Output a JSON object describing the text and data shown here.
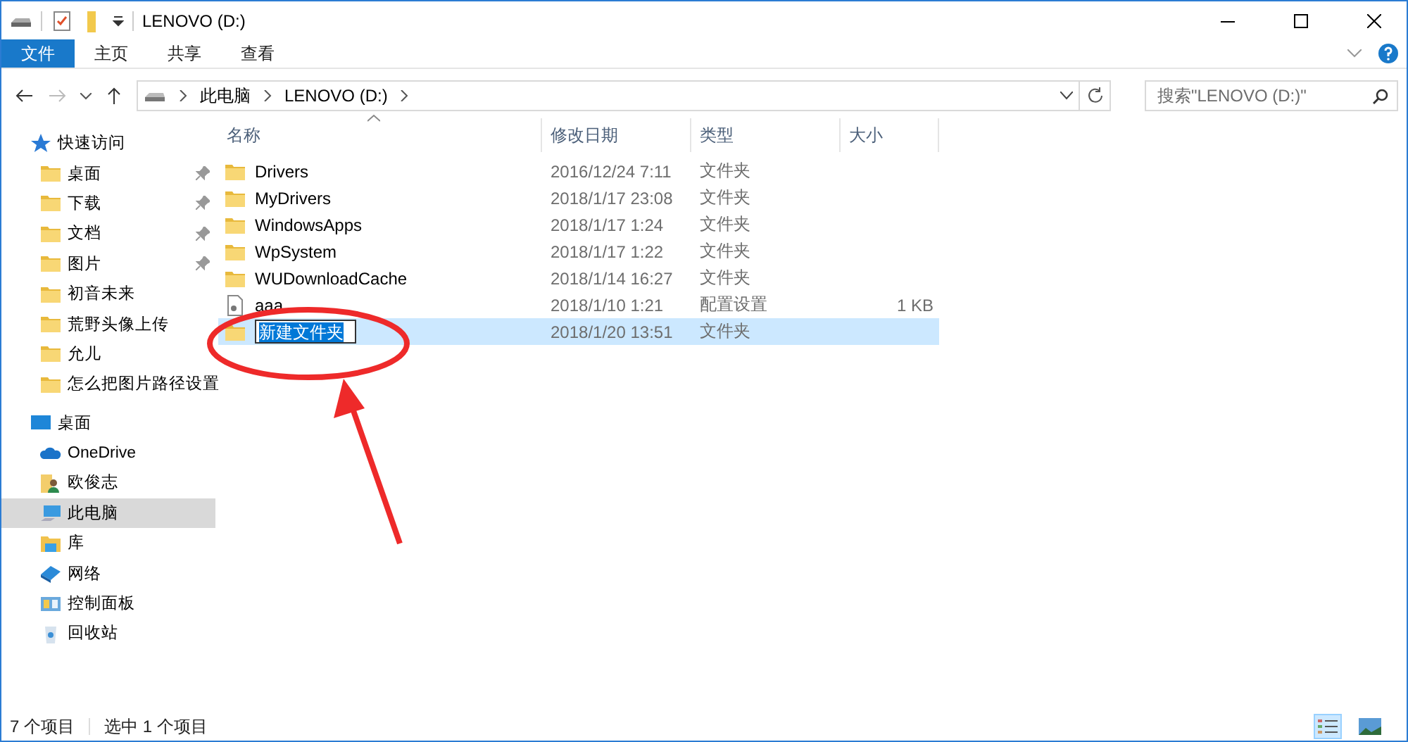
{
  "window": {
    "title": "LENOVO (D:)"
  },
  "ribbon_tabs": [
    {
      "label": "文件",
      "kind": "file",
      "selected": false
    },
    {
      "label": "主页",
      "kind": "tab",
      "selected": false
    },
    {
      "label": "共享",
      "kind": "tab",
      "selected": false
    },
    {
      "label": "查看",
      "kind": "tab",
      "selected": false
    }
  ],
  "address": {
    "crumbs": [
      "此电脑",
      "LENOVO (D:)"
    ]
  },
  "search": {
    "placeholder": "搜索\"LENOVO (D:)\""
  },
  "sidebar": {
    "items": [
      {
        "label": "快速访问",
        "kind": "star",
        "selected": false,
        "children": [
          {
            "label": "桌面",
            "kind": "desktop-folder",
            "selected": false,
            "pinned": true
          },
          {
            "label": "下载",
            "kind": "download-folder",
            "selected": false,
            "pinned": true
          },
          {
            "label": "文档",
            "kind": "doc-folder",
            "selected": false,
            "pinned": true
          },
          {
            "label": "图片",
            "kind": "picture-folder",
            "selected": false,
            "pinned": true
          },
          {
            "label": "初音未来",
            "kind": "folder",
            "selected": false,
            "pinned": false
          },
          {
            "label": "荒野头像上传",
            "kind": "folder",
            "selected": false,
            "pinned": false
          },
          {
            "label": "允儿",
            "kind": "folder",
            "selected": false,
            "pinned": false
          },
          {
            "label": "怎么把图片路径设置",
            "kind": "folder",
            "selected": false,
            "pinned": false
          }
        ]
      },
      {
        "label": "桌面",
        "kind": "desktop",
        "selected": false,
        "children": [
          {
            "label": "OneDrive",
            "kind": "cloud",
            "selected": false,
            "pinned": false
          },
          {
            "label": "欧俊志",
            "kind": "user",
            "selected": false,
            "pinned": false
          },
          {
            "label": "此电脑",
            "kind": "pc",
            "selected": true,
            "pinned": false
          },
          {
            "label": "库",
            "kind": "library",
            "selected": false,
            "pinned": false
          },
          {
            "label": "网络",
            "kind": "network",
            "selected": false,
            "pinned": false
          },
          {
            "label": "控制面板",
            "kind": "control-panel",
            "selected": false,
            "pinned": false
          },
          {
            "label": "回收站",
            "kind": "bin",
            "selected": false,
            "pinned": false
          }
        ]
      }
    ]
  },
  "table": {
    "columns": [
      "名称",
      "修改日期",
      "类型",
      "大小"
    ],
    "rows": [
      {
        "name": "Drivers",
        "date": "2016/12/24 7:11",
        "type": "文件夹",
        "kind": "folder",
        "selected": false,
        "renaming": false
      },
      {
        "name": "MyDrivers",
        "date": "2018/1/17 23:08",
        "type": "文件夹",
        "kind": "folder",
        "selected": false,
        "renaming": false
      },
      {
        "name": "WindowsApps",
        "date": "2018/1/17 1:24",
        "type": "文件夹",
        "kind": "folder",
        "selected": false,
        "renaming": false
      },
      {
        "name": "WpSystem",
        "date": "2018/1/17 1:22",
        "type": "文件夹",
        "kind": "folder",
        "selected": false,
        "renaming": false
      },
      {
        "name": "WUDownloadCache",
        "date": "2018/1/14 16:27",
        "type": "文件夹",
        "kind": "folder",
        "selected": false,
        "renaming": false
      },
      {
        "name": "aaa",
        "date": "2018/1/10 1:21",
        "type": "配置设置",
        "size": "1 KB",
        "kind": "file",
        "selected": false,
        "renaming": false
      },
      {
        "name": "新建文件夹",
        "date": "2018/1/20 13:51",
        "type": "文件夹",
        "kind": "folder",
        "selected": true,
        "renaming": true
      }
    ]
  },
  "status_bar": {
    "count": "7 个项目",
    "selection": "选中 1 个项目",
    "views": [
      {
        "kind": "details",
        "selected": true
      },
      {
        "kind": "tiles",
        "selected": false
      }
    ]
  }
}
